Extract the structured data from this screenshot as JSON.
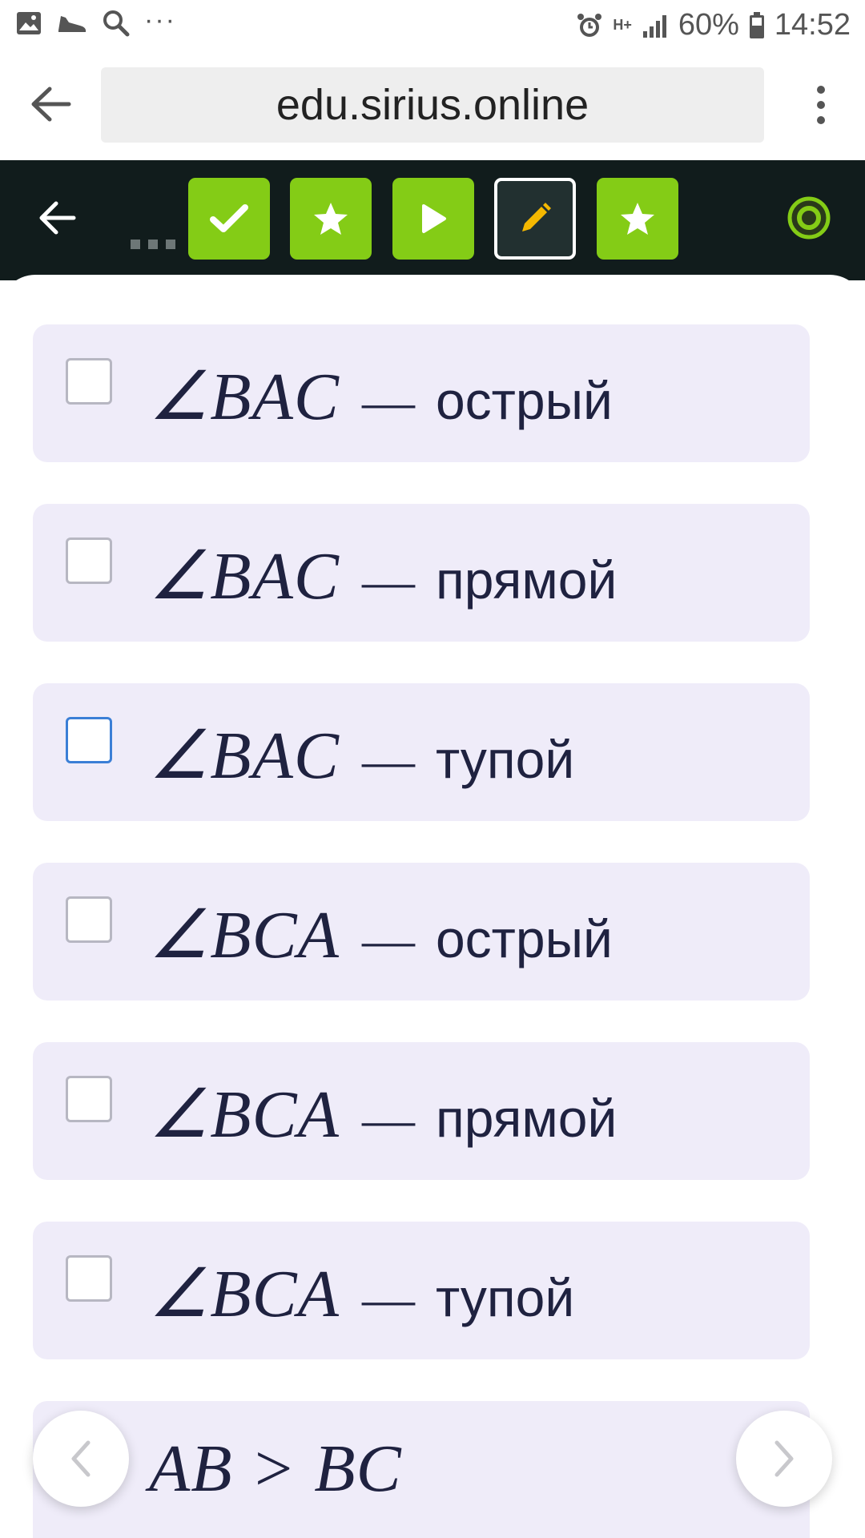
{
  "status_bar": {
    "battery": "60%",
    "time": "14:52",
    "network": "H+"
  },
  "browser": {
    "url": "edu.sirius.online"
  },
  "steps": [
    {
      "icon": "check-icon",
      "state": "done"
    },
    {
      "icon": "star-icon",
      "state": "done"
    },
    {
      "icon": "play-icon",
      "state": "done"
    },
    {
      "icon": "pencil-icon",
      "state": "current"
    },
    {
      "icon": "star-icon",
      "state": "done"
    }
  ],
  "colors": {
    "accent_green": "#84cc16",
    "header_bg": "#111c1c",
    "option_bg": "#efecf9",
    "focus_blue": "#3b7fd6",
    "pencil_yellow": "#f5b800"
  },
  "options": [
    {
      "math": "∠BAC",
      "dash": "—",
      "word": "острый"
    },
    {
      "math": "∠BAC",
      "dash": "—",
      "word": "прямой"
    },
    {
      "math": "∠BAC",
      "dash": "—",
      "word": "тупой"
    },
    {
      "math": "∠BCA",
      "dash": "—",
      "word": "острый"
    },
    {
      "math": "∠BCA",
      "dash": "—",
      "word": "прямой"
    },
    {
      "math": "∠BCA",
      "dash": "—",
      "word": "тупой"
    },
    {
      "math": "AB > BC"
    }
  ]
}
